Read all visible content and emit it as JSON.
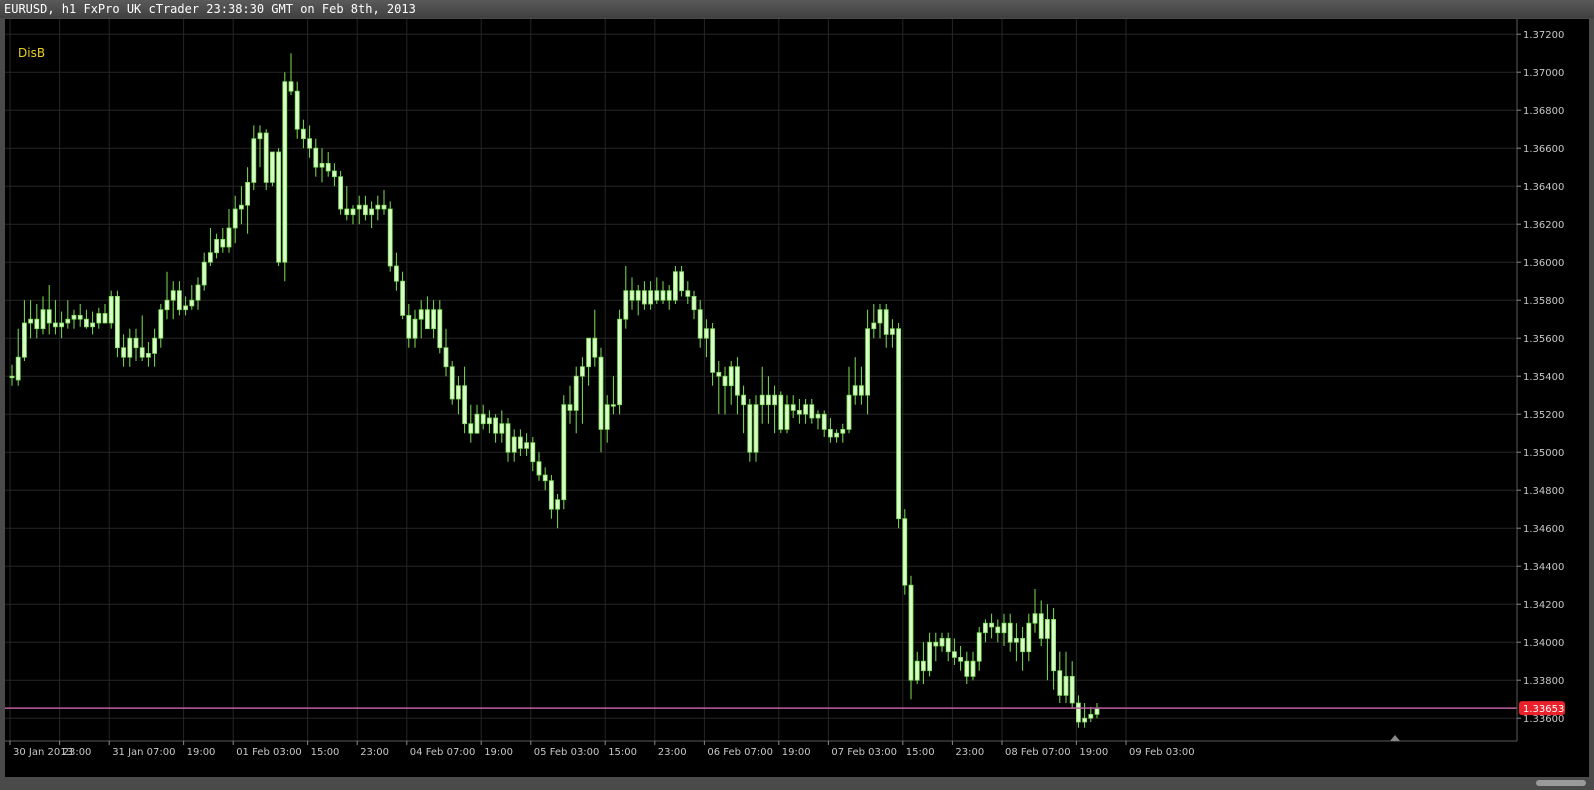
{
  "window": {
    "title": "EURUSD, h1 FxPro UK cTrader 23:38:30 GMT on Feb 8th, 2013"
  },
  "indicator_label": "DisB",
  "current_price": {
    "label": "1.33653",
    "value": 1.33653,
    "line_color": "#c060a0",
    "badge_color": "#e8212b"
  },
  "colors": {
    "candle_up": "#7de055",
    "candle_up_body": "#d8ffc8",
    "candle_down": "#7de055",
    "grid": "#262626",
    "axis_text": "#c8c8c8",
    "indicator_text": "#e8d020",
    "background": "#000000"
  },
  "chart_data": {
    "type": "candlestick",
    "symbol": "EURUSD",
    "timeframe": "h1",
    "ylim": [
      1.3348,
      1.3728
    ],
    "y_ticks": [
      "1.37200",
      "1.37000",
      "1.36800",
      "1.36600",
      "1.36400",
      "1.36200",
      "1.36000",
      "1.35800",
      "1.35600",
      "1.35400",
      "1.35200",
      "1.35000",
      "1.34800",
      "1.34600",
      "1.34400",
      "1.34200",
      "1.34000",
      "1.33800",
      "1.33600"
    ],
    "y_tick_values": [
      1.372,
      1.37,
      1.368,
      1.366,
      1.364,
      1.362,
      1.36,
      1.358,
      1.356,
      1.354,
      1.352,
      1.35,
      1.348,
      1.346,
      1.344,
      1.342,
      1.34,
      1.338,
      1.336
    ],
    "x_ticks": [
      {
        "label": "30 Jan 2013",
        "bar": 0
      },
      {
        "label": "23:00",
        "bar": 8
      },
      {
        "label": "31 Jan 07:00",
        "bar": 16
      },
      {
        "label": "19:00",
        "bar": 28
      },
      {
        "label": "01 Feb 03:00",
        "bar": 36
      },
      {
        "label": "15:00",
        "bar": 48
      },
      {
        "label": "23:00",
        "bar": 56
      },
      {
        "label": "04 Feb 07:00",
        "bar": 64
      },
      {
        "label": "19:00",
        "bar": 76
      },
      {
        "label": "05 Feb 03:00",
        "bar": 84
      },
      {
        "label": "15:00",
        "bar": 96
      },
      {
        "label": "23:00",
        "bar": 104
      },
      {
        "label": "06 Feb 07:00",
        "bar": 112
      },
      {
        "label": "19:00",
        "bar": 124
      },
      {
        "label": "07 Feb 03:00",
        "bar": 132
      },
      {
        "label": "15:00",
        "bar": 144
      },
      {
        "label": "23:00",
        "bar": 152
      },
      {
        "label": "08 Feb 07:00",
        "bar": 160
      },
      {
        "label": "19:00",
        "bar": 172
      },
      {
        "label": "09 Feb 03:00",
        "bar": 180
      }
    ],
    "candles": [
      [
        1.354,
        1.3546,
        1.3535,
        1.354
      ],
      [
        1.3538,
        1.3565,
        1.3535,
        1.355
      ],
      [
        1.355,
        1.358,
        1.3548,
        1.3568
      ],
      [
        1.3568,
        1.358,
        1.356,
        1.357
      ],
      [
        1.357,
        1.3578,
        1.356,
        1.3565
      ],
      [
        1.3565,
        1.3582,
        1.3562,
        1.3575
      ],
      [
        1.3575,
        1.3588,
        1.3562,
        1.3568
      ],
      [
        1.3568,
        1.358,
        1.3562,
        1.3566
      ],
      [
        1.3566,
        1.3574,
        1.356,
        1.3568
      ],
      [
        1.3568,
        1.358,
        1.3565,
        1.357
      ],
      [
        1.357,
        1.3575,
        1.3565,
        1.3572
      ],
      [
        1.3572,
        1.3578,
        1.3566,
        1.357
      ],
      [
        1.357,
        1.3575,
        1.3565,
        1.3566
      ],
      [
        1.3566,
        1.3574,
        1.3562,
        1.3568
      ],
      [
        1.3568,
        1.3576,
        1.3565,
        1.3573
      ],
      [
        1.3573,
        1.3578,
        1.3568,
        1.3568
      ],
      [
        1.3568,
        1.3585,
        1.3565,
        1.3582
      ],
      [
        1.3582,
        1.3585,
        1.355,
        1.3555
      ],
      [
        1.3555,
        1.3562,
        1.3545,
        1.355
      ],
      [
        1.355,
        1.3565,
        1.3545,
        1.356
      ],
      [
        1.356,
        1.3565,
        1.3548,
        1.3555
      ],
      [
        1.3555,
        1.3572,
        1.3548,
        1.355
      ],
      [
        1.355,
        1.3558,
        1.3545,
        1.3552
      ],
      [
        1.3552,
        1.3565,
        1.3545,
        1.356
      ],
      [
        1.356,
        1.3578,
        1.3555,
        1.3575
      ],
      [
        1.3575,
        1.3595,
        1.357,
        1.358
      ],
      [
        1.358,
        1.359,
        1.357,
        1.3585
      ],
      [
        1.3585,
        1.359,
        1.3572,
        1.3575
      ],
      [
        1.3575,
        1.3582,
        1.3572,
        1.3577
      ],
      [
        1.3577,
        1.3588,
        1.3575,
        1.358
      ],
      [
        1.358,
        1.3592,
        1.3575,
        1.3588
      ],
      [
        1.3588,
        1.3605,
        1.3585,
        1.36
      ],
      [
        1.36,
        1.3618,
        1.3598,
        1.3605
      ],
      [
        1.3605,
        1.3615,
        1.3602,
        1.3612
      ],
      [
        1.3612,
        1.3618,
        1.3605,
        1.3608
      ],
      [
        1.3608,
        1.3628,
        1.3605,
        1.3618
      ],
      [
        1.3618,
        1.3635,
        1.361,
        1.3628
      ],
      [
        1.3628,
        1.364,
        1.362,
        1.363
      ],
      [
        1.363,
        1.365,
        1.3615,
        1.3642
      ],
      [
        1.3642,
        1.3672,
        1.3638,
        1.3665
      ],
      [
        1.3665,
        1.3672,
        1.365,
        1.3668
      ],
      [
        1.3668,
        1.367,
        1.3638,
        1.3642
      ],
      [
        1.3642,
        1.3658,
        1.364,
        1.3658
      ],
      [
        1.3658,
        1.366,
        1.3598,
        1.36
      ],
      [
        1.36,
        1.37,
        1.359,
        1.3695
      ],
      [
        1.3695,
        1.371,
        1.3688,
        1.369
      ],
      [
        1.369,
        1.3695,
        1.3665,
        1.367
      ],
      [
        1.367,
        1.3675,
        1.366,
        1.3665
      ],
      [
        1.3665,
        1.3672,
        1.3655,
        1.366
      ],
      [
        1.366,
        1.3665,
        1.3645,
        1.365
      ],
      [
        1.365,
        1.366,
        1.3642,
        1.3652
      ],
      [
        1.3652,
        1.3658,
        1.3645,
        1.3648
      ],
      [
        1.3648,
        1.3652,
        1.364,
        1.3645
      ],
      [
        1.3645,
        1.3648,
        1.3625,
        1.3628
      ],
      [
        1.3628,
        1.364,
        1.3622,
        1.3625
      ],
      [
        1.3625,
        1.363,
        1.362,
        1.3628
      ],
      [
        1.3628,
        1.3635,
        1.362,
        1.363
      ],
      [
        1.363,
        1.3635,
        1.3622,
        1.3625
      ],
      [
        1.3625,
        1.3632,
        1.3618,
        1.3628
      ],
      [
        1.3628,
        1.3635,
        1.3622,
        1.363
      ],
      [
        1.363,
        1.3638,
        1.3625,
        1.3628
      ],
      [
        1.3628,
        1.3632,
        1.3595,
        1.3598
      ],
      [
        1.3598,
        1.3605,
        1.3585,
        1.359
      ],
      [
        1.359,
        1.3595,
        1.357,
        1.3572
      ],
      [
        1.3572,
        1.3578,
        1.3555,
        1.356
      ],
      [
        1.356,
        1.3575,
        1.3555,
        1.357
      ],
      [
        1.357,
        1.358,
        1.356,
        1.3575
      ],
      [
        1.3575,
        1.3582,
        1.3565,
        1.3565
      ],
      [
        1.3565,
        1.358,
        1.356,
        1.3575
      ],
      [
        1.3575,
        1.358,
        1.3552,
        1.3555
      ],
      [
        1.3555,
        1.3565,
        1.354,
        1.3545
      ],
      [
        1.3545,
        1.3548,
        1.3525,
        1.3528
      ],
      [
        1.3528,
        1.354,
        1.352,
        1.3535
      ],
      [
        1.3535,
        1.3545,
        1.351,
        1.3515
      ],
      [
        1.3515,
        1.3525,
        1.3505,
        1.351
      ],
      [
        1.351,
        1.3525,
        1.351,
        1.352
      ],
      [
        1.352,
        1.3525,
        1.3512,
        1.3515
      ],
      [
        1.3515,
        1.3522,
        1.351,
        1.3518
      ],
      [
        1.3518,
        1.352,
        1.3505,
        1.351
      ],
      [
        1.351,
        1.3522,
        1.3505,
        1.3515
      ],
      [
        1.3515,
        1.3518,
        1.3495,
        1.35
      ],
      [
        1.35,
        1.3512,
        1.3495,
        1.3508
      ],
      [
        1.3508,
        1.3512,
        1.3498,
        1.3502
      ],
      [
        1.3502,
        1.351,
        1.3498,
        1.3505
      ],
      [
        1.3505,
        1.3508,
        1.349,
        1.3495
      ],
      [
        1.3495,
        1.35,
        1.3485,
        1.3488
      ],
      [
        1.3488,
        1.3492,
        1.348,
        1.3485
      ],
      [
        1.3485,
        1.3488,
        1.3465,
        1.347
      ],
      [
        1.347,
        1.3478,
        1.346,
        1.3475
      ],
      [
        1.3475,
        1.353,
        1.347,
        1.3525
      ],
      [
        1.3525,
        1.3535,
        1.3515,
        1.3522
      ],
      [
        1.3522,
        1.3545,
        1.351,
        1.354
      ],
      [
        1.354,
        1.355,
        1.3515,
        1.3545
      ],
      [
        1.3545,
        1.356,
        1.3535,
        1.356
      ],
      [
        1.356,
        1.3575,
        1.3545,
        1.355
      ],
      [
        1.355,
        1.3555,
        1.35,
        1.3512
      ],
      [
        1.3512,
        1.353,
        1.3505,
        1.3525
      ],
      [
        1.3525,
        1.354,
        1.352,
        1.3525
      ],
      [
        1.3525,
        1.3575,
        1.352,
        1.357
      ],
      [
        1.357,
        1.3598,
        1.3565,
        1.3585
      ],
      [
        1.3585,
        1.3592,
        1.3575,
        1.358
      ],
      [
        1.358,
        1.3588,
        1.3572,
        1.3585
      ],
      [
        1.3585,
        1.359,
        1.3575,
        1.3578
      ],
      [
        1.3578,
        1.359,
        1.3575,
        1.3585
      ],
      [
        1.3585,
        1.3592,
        1.3578,
        1.358
      ],
      [
        1.358,
        1.359,
        1.3578,
        1.3585
      ],
      [
        1.3585,
        1.3588,
        1.3575,
        1.358
      ],
      [
        1.358,
        1.3598,
        1.3578,
        1.3595
      ],
      [
        1.3595,
        1.3598,
        1.3582,
        1.3585
      ],
      [
        1.3585,
        1.359,
        1.3578,
        1.3582
      ],
      [
        1.3582,
        1.3585,
        1.357,
        1.3575
      ],
      [
        1.3575,
        1.358,
        1.3555,
        1.356
      ],
      [
        1.356,
        1.357,
        1.355,
        1.3565
      ],
      [
        1.3565,
        1.3568,
        1.3535,
        1.3542
      ],
      [
        1.3542,
        1.3548,
        1.352,
        1.354
      ],
      [
        1.354,
        1.3545,
        1.352,
        1.3535
      ],
      [
        1.3535,
        1.3548,
        1.3525,
        1.3545
      ],
      [
        1.3545,
        1.355,
        1.352,
        1.353
      ],
      [
        1.353,
        1.3535,
        1.351,
        1.3525
      ],
      [
        1.3525,
        1.3528,
        1.3495,
        1.35
      ],
      [
        1.35,
        1.353,
        1.3495,
        1.3525
      ],
      [
        1.3525,
        1.3545,
        1.3515,
        1.353
      ],
      [
        1.353,
        1.354,
        1.3515,
        1.3525
      ],
      [
        1.3525,
        1.3535,
        1.351,
        1.353
      ],
      [
        1.353,
        1.3532,
        1.351,
        1.3512
      ],
      [
        1.3512,
        1.353,
        1.351,
        1.3525
      ],
      [
        1.3525,
        1.353,
        1.3518,
        1.3522
      ],
      [
        1.3522,
        1.3528,
        1.3515,
        1.352
      ],
      [
        1.352,
        1.3528,
        1.3515,
        1.3525
      ],
      [
        1.3525,
        1.3528,
        1.3515,
        1.3518
      ],
      [
        1.3518,
        1.3522,
        1.3512,
        1.352
      ],
      [
        1.352,
        1.3522,
        1.3508,
        1.3512
      ],
      [
        1.3512,
        1.3518,
        1.3505,
        1.3508
      ],
      [
        1.3508,
        1.3512,
        1.3505,
        1.351
      ],
      [
        1.351,
        1.3515,
        1.3505,
        1.3512
      ],
      [
        1.3512,
        1.3545,
        1.351,
        1.353
      ],
      [
        1.353,
        1.355,
        1.3525,
        1.3535
      ],
      [
        1.3535,
        1.3545,
        1.3525,
        1.353
      ],
      [
        1.353,
        1.3575,
        1.352,
        1.3565
      ],
      [
        1.3565,
        1.3578,
        1.356,
        1.3568
      ],
      [
        1.3568,
        1.3578,
        1.356,
        1.3575
      ],
      [
        1.3575,
        1.3578,
        1.3555,
        1.3562
      ],
      [
        1.3562,
        1.357,
        1.3555,
        1.3565
      ],
      [
        1.3565,
        1.3568,
        1.346,
        1.3465
      ],
      [
        1.3465,
        1.347,
        1.3425,
        1.343
      ],
      [
        1.343,
        1.3435,
        1.337,
        1.338
      ],
      [
        1.338,
        1.3395,
        1.3378,
        1.339
      ],
      [
        1.339,
        1.34,
        1.3378,
        1.3385
      ],
      [
        1.3385,
        1.3405,
        1.3382,
        1.34
      ],
      [
        1.34,
        1.3405,
        1.339,
        1.3398
      ],
      [
        1.3398,
        1.3405,
        1.3395,
        1.3402
      ],
      [
        1.3402,
        1.3405,
        1.339,
        1.3395
      ],
      [
        1.3395,
        1.3402,
        1.3388,
        1.3392
      ],
      [
        1.3392,
        1.3398,
        1.3385,
        1.339
      ],
      [
        1.339,
        1.3395,
        1.3378,
        1.3382
      ],
      [
        1.3382,
        1.3395,
        1.338,
        1.339
      ],
      [
        1.339,
        1.3408,
        1.3385,
        1.3405
      ],
      [
        1.3405,
        1.3412,
        1.34,
        1.341
      ],
      [
        1.341,
        1.3415,
        1.3402,
        1.3408
      ],
      [
        1.3408,
        1.3412,
        1.34,
        1.3405
      ],
      [
        1.3405,
        1.3415,
        1.3398,
        1.341
      ],
      [
        1.341,
        1.3415,
        1.3395,
        1.34
      ],
      [
        1.34,
        1.341,
        1.339,
        1.3402
      ],
      [
        1.3402,
        1.3408,
        1.3385,
        1.3395
      ],
      [
        1.3395,
        1.3415,
        1.339,
        1.341
      ],
      [
        1.341,
        1.3428,
        1.3405,
        1.3415
      ],
      [
        1.3415,
        1.3422,
        1.3398,
        1.3402
      ],
      [
        1.3402,
        1.342,
        1.338,
        1.3412
      ],
      [
        1.3412,
        1.3418,
        1.3375,
        1.3385
      ],
      [
        1.3385,
        1.3395,
        1.3368,
        1.3372
      ],
      [
        1.3372,
        1.3395,
        1.3368,
        1.3382
      ],
      [
        1.3382,
        1.339,
        1.3365,
        1.3368
      ],
      [
        1.3368,
        1.3372,
        1.3355,
        1.3358
      ],
      [
        1.3358,
        1.3368,
        1.3355,
        1.336
      ],
      [
        1.336,
        1.3366,
        1.3358,
        1.3362
      ],
      [
        1.3362,
        1.3368,
        1.336,
        1.3365
      ]
    ]
  }
}
